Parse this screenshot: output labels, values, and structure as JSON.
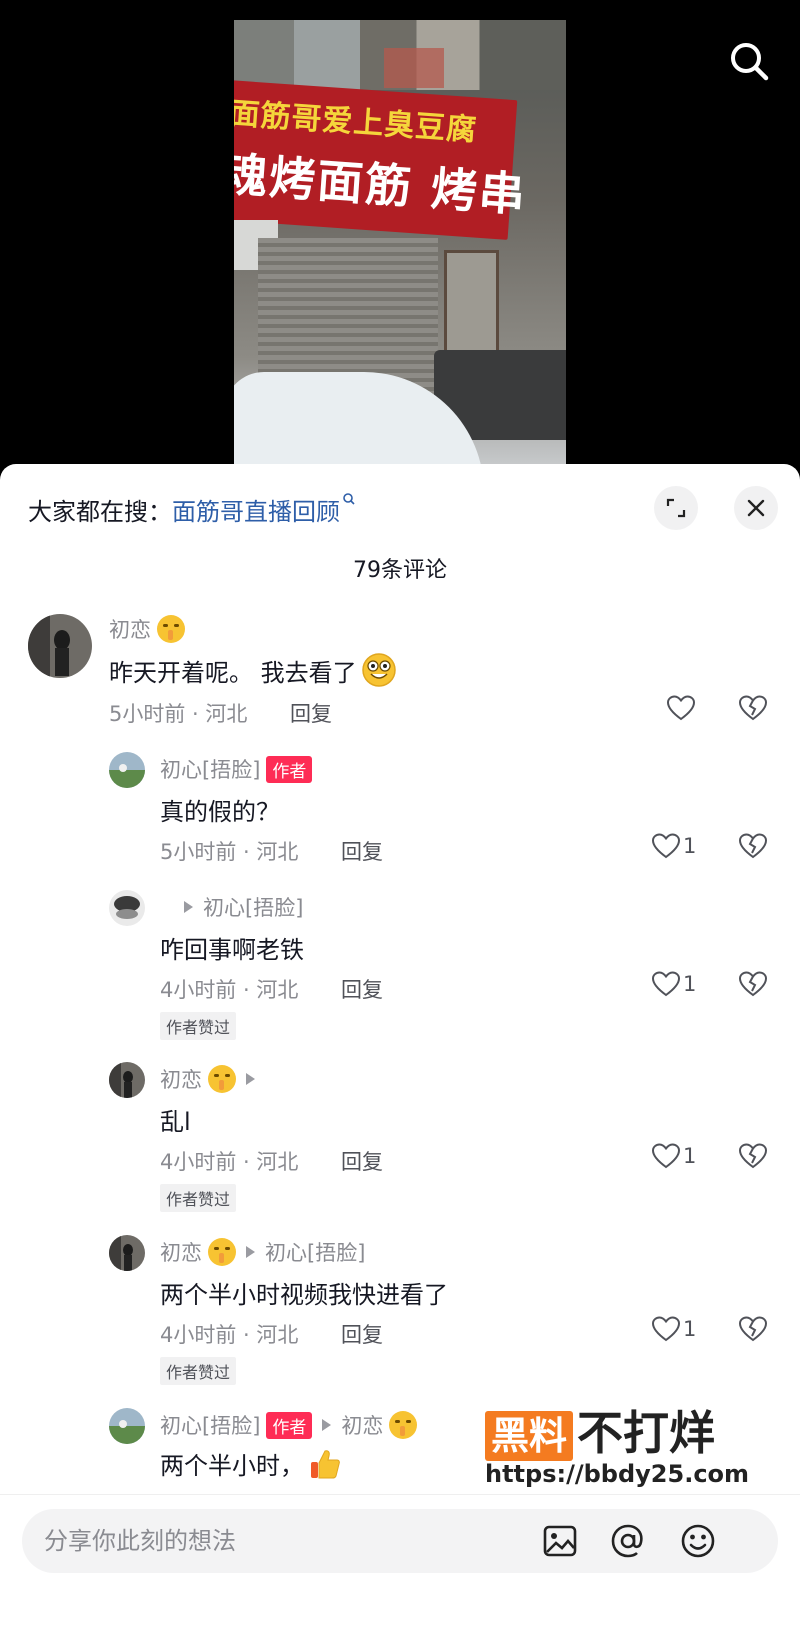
{
  "video": {
    "sign_line1": "面筋哥爱上臭豆腐",
    "sign_line2": "魂烤面筋 烤串"
  },
  "sheet": {
    "suggest_prefix": "大家都在搜：",
    "suggest_link": "面筋哥直播回顾",
    "comment_count": "79条评论"
  },
  "comments": [
    {
      "name": "初恋",
      "text": "昨天开着呢。 我去看了",
      "meta": "5小时前 · 河北",
      "reply": "回复",
      "likes": ""
    },
    {
      "name": "初心[捂脸]",
      "badge": "作者",
      "text": "真的假的？",
      "meta": "5小时前 · 河北",
      "reply": "回复",
      "likes": "1"
    },
    {
      "reply_to": "初心[捂脸]",
      "text": "咋回事啊老铁",
      "meta": "4小时前 · 河北",
      "reply": "回复",
      "likes": "1",
      "tag": "作者赞过"
    },
    {
      "name": "初恋",
      "text": "乱l",
      "meta": "4小时前 · 河北",
      "reply": "回复",
      "likes": "1",
      "tag": "作者赞过"
    },
    {
      "name": "初恋",
      "reply_to": "初心[捂脸]",
      "text": "两个半小时视频我快进看了",
      "meta": "4小时前 · 河北",
      "reply": "回复",
      "likes": "1",
      "tag": "作者赞过"
    },
    {
      "name": "初心[捂脸]",
      "badge": "作者",
      "reply_to": "初恋",
      "text": "两个半小时，"
    }
  ],
  "watermark": {
    "box": "黑料",
    "text": "不打烊",
    "url": "https://bbdy25.com"
  },
  "input": {
    "placeholder": "分享你此刻的想法"
  },
  "colors": {
    "accent_red": "#fe2c55",
    "link_blue": "#2e5ea8",
    "watermark_orange": "#f47b20"
  }
}
